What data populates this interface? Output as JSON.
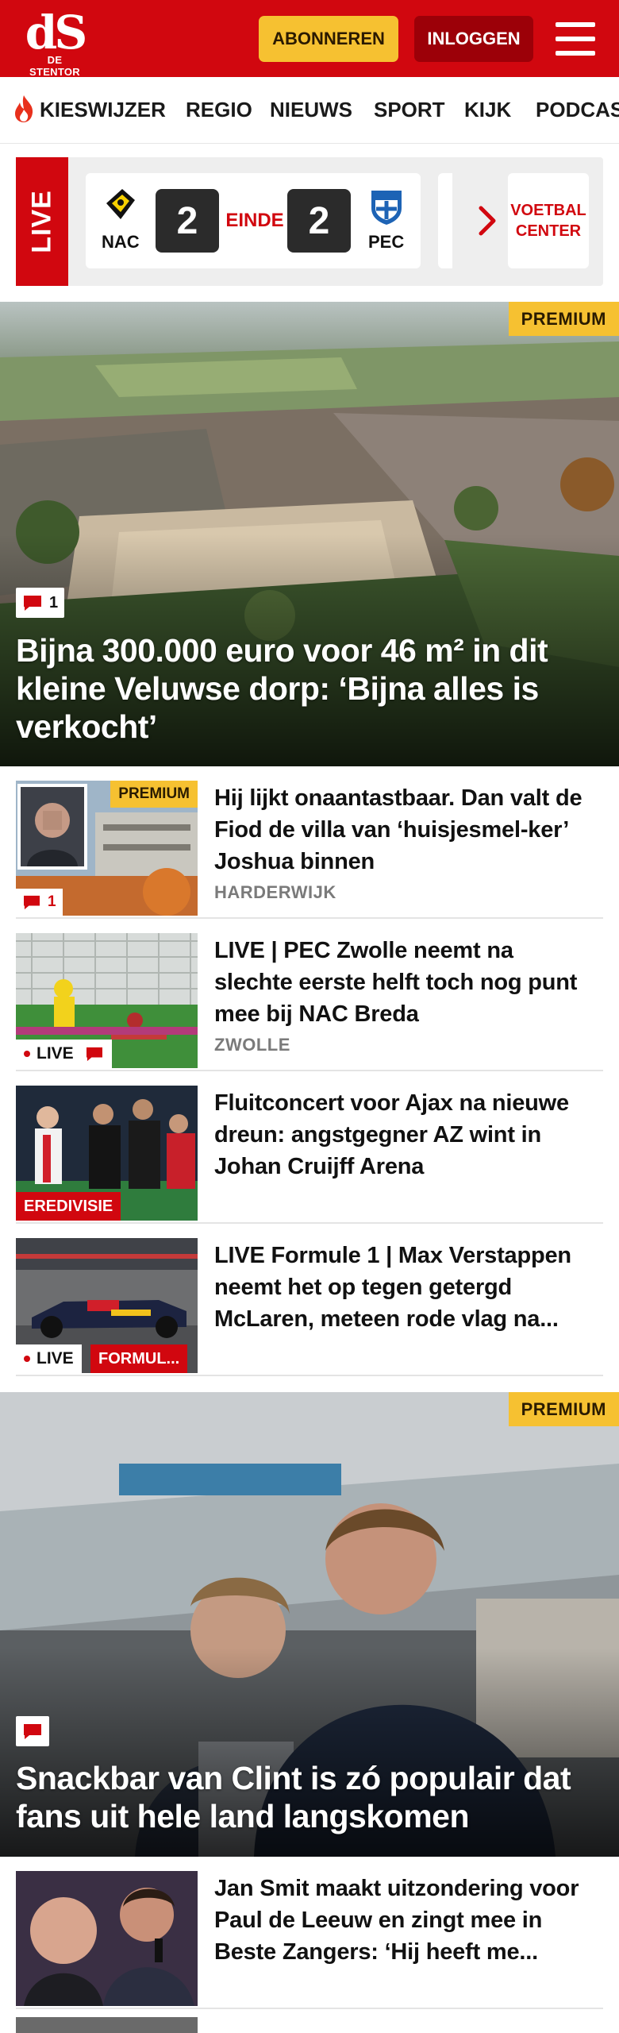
{
  "header": {
    "logo_mark": "dS",
    "logo_sub": "DE STENTOR",
    "subscribe_label": "ABONNEREN",
    "login_label": "INLOGGEN",
    "menu_icon": "hamburger-icon",
    "brand_color": "#d1070f",
    "accent_color": "#f6c131"
  },
  "nav": {
    "items": [
      "KIESWIJZER",
      "REGIO",
      "NIEUWS",
      "SPORT",
      "KIJK",
      "PODCAS"
    ],
    "first_item_icon": "flame-icon"
  },
  "live_widget": {
    "label": "LIVE",
    "home_team": "NAC",
    "away_team": "PEC",
    "home_score": "2",
    "away_score": "2",
    "status": "EINDE",
    "voetbal_center_label": "VOETBAL\nCENTER"
  },
  "hero1": {
    "premium_label": "PREMIUM",
    "comment_count": "1",
    "title": "Bijna 300.000 euro voor 46 m² in dit kleine Veluwse dorp: ‘Bijna alles is verkocht’"
  },
  "articles": [
    {
      "title": "Hij lijkt onaantastbaar. Dan valt de Fiod de villa van ‘huisjesmel-ker’ Joshua binnen",
      "tag": "HARDERWIJK",
      "premium_label": "PREMIUM",
      "comment_count": "1"
    },
    {
      "title": "LIVE | PEC Zwolle neemt na slechte eerste helft toch nog punt mee bij NAC Breda",
      "tag": "ZWOLLE",
      "live_label": "LIVE"
    },
    {
      "title": "Fluitconcert voor Ajax na nieuwe dreun: angstgegner AZ wint in Johan Cruijff Arena",
      "badge": "EREDIVISIE"
    },
    {
      "title": "LIVE Formule 1 | Max Verstappen neemt het op tegen getergd McLaren, meteen rode vlag na...",
      "live_label": "LIVE",
      "badge": "FORMUL..."
    },
    {
      "title": "Jan Smit maakt uitzondering voor Paul de Leeuw en zingt mee in Beste Zangers: ‘Hij heeft me..."
    }
  ],
  "hero2": {
    "premium_label": "PREMIUM",
    "title": "Snackbar van Clint is zó populair dat fans uit hele land langskomen"
  }
}
